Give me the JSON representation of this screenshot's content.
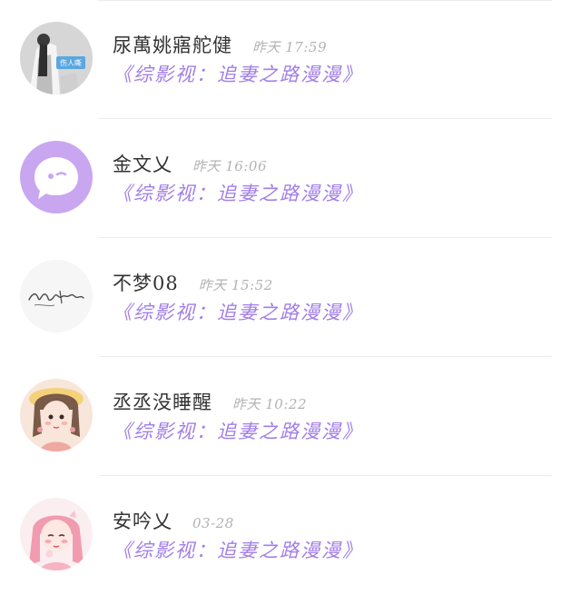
{
  "comments": [
    {
      "name": "尿萬姚寤舵健",
      "time": "昨天 17:59",
      "message": "《综影视：追妻之路漫漫》",
      "avatar_icon": "photo-avatar-girl-sign"
    },
    {
      "name": "金文乂",
      "time": "昨天 16:06",
      "message": "《综影视：追妻之路漫漫》",
      "avatar_icon": "purple-chat-bubble-avatar"
    },
    {
      "name": "不梦08",
      "time": "昨天 15:52",
      "message": "《综影视：追妻之路漫漫》",
      "avatar_icon": "handwriting-avatar"
    },
    {
      "name": "丞丞没睡醒",
      "time": "昨天 10:22",
      "message": "《综影视：追妻之路漫漫》",
      "avatar_icon": "illustrated-girl-avatar"
    },
    {
      "name": "安吟乂",
      "time": "03-28",
      "message": "《综影视：追妻之路漫漫》",
      "avatar_icon": "pink-hair-girl-avatar"
    }
  ],
  "colors": {
    "message": "#a27ee8",
    "name": "#333333",
    "time": "#b3b3b3",
    "avatar_purple": "#c9a6f0"
  }
}
